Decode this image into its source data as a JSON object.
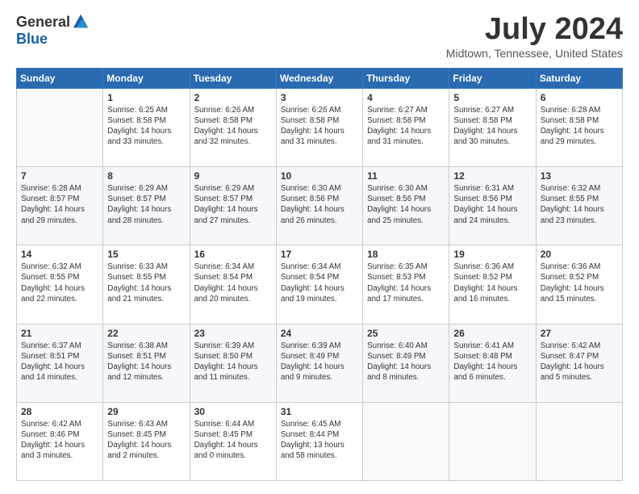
{
  "logo": {
    "general": "General",
    "blue": "Blue"
  },
  "title": "July 2024",
  "subtitle": "Midtown, Tennessee, United States",
  "days_of_week": [
    "Sunday",
    "Monday",
    "Tuesday",
    "Wednesday",
    "Thursday",
    "Friday",
    "Saturday"
  ],
  "weeks": [
    [
      {
        "day": "",
        "info": ""
      },
      {
        "day": "1",
        "info": "Sunrise: 6:25 AM\nSunset: 8:58 PM\nDaylight: 14 hours\nand 33 minutes."
      },
      {
        "day": "2",
        "info": "Sunrise: 6:26 AM\nSunset: 8:58 PM\nDaylight: 14 hours\nand 32 minutes."
      },
      {
        "day": "3",
        "info": "Sunrise: 6:26 AM\nSunset: 8:58 PM\nDaylight: 14 hours\nand 31 minutes."
      },
      {
        "day": "4",
        "info": "Sunrise: 6:27 AM\nSunset: 8:58 PM\nDaylight: 14 hours\nand 31 minutes."
      },
      {
        "day": "5",
        "info": "Sunrise: 6:27 AM\nSunset: 8:58 PM\nDaylight: 14 hours\nand 30 minutes."
      },
      {
        "day": "6",
        "info": "Sunrise: 6:28 AM\nSunset: 8:58 PM\nDaylight: 14 hours\nand 29 minutes."
      }
    ],
    [
      {
        "day": "7",
        "info": "Sunrise: 6:28 AM\nSunset: 8:57 PM\nDaylight: 14 hours\nand 29 minutes."
      },
      {
        "day": "8",
        "info": "Sunrise: 6:29 AM\nSunset: 8:57 PM\nDaylight: 14 hours\nand 28 minutes."
      },
      {
        "day": "9",
        "info": "Sunrise: 6:29 AM\nSunset: 8:57 PM\nDaylight: 14 hours\nand 27 minutes."
      },
      {
        "day": "10",
        "info": "Sunrise: 6:30 AM\nSunset: 8:56 PM\nDaylight: 14 hours\nand 26 minutes."
      },
      {
        "day": "11",
        "info": "Sunrise: 6:30 AM\nSunset: 8:56 PM\nDaylight: 14 hours\nand 25 minutes."
      },
      {
        "day": "12",
        "info": "Sunrise: 6:31 AM\nSunset: 8:56 PM\nDaylight: 14 hours\nand 24 minutes."
      },
      {
        "day": "13",
        "info": "Sunrise: 6:32 AM\nSunset: 8:55 PM\nDaylight: 14 hours\nand 23 minutes."
      }
    ],
    [
      {
        "day": "14",
        "info": "Sunrise: 6:32 AM\nSunset: 8:55 PM\nDaylight: 14 hours\nand 22 minutes."
      },
      {
        "day": "15",
        "info": "Sunrise: 6:33 AM\nSunset: 8:55 PM\nDaylight: 14 hours\nand 21 minutes."
      },
      {
        "day": "16",
        "info": "Sunrise: 6:34 AM\nSunset: 8:54 PM\nDaylight: 14 hours\nand 20 minutes."
      },
      {
        "day": "17",
        "info": "Sunrise: 6:34 AM\nSunset: 8:54 PM\nDaylight: 14 hours\nand 19 minutes."
      },
      {
        "day": "18",
        "info": "Sunrise: 6:35 AM\nSunset: 8:53 PM\nDaylight: 14 hours\nand 17 minutes."
      },
      {
        "day": "19",
        "info": "Sunrise: 6:36 AM\nSunset: 8:52 PM\nDaylight: 14 hours\nand 16 minutes."
      },
      {
        "day": "20",
        "info": "Sunrise: 6:36 AM\nSunset: 8:52 PM\nDaylight: 14 hours\nand 15 minutes."
      }
    ],
    [
      {
        "day": "21",
        "info": "Sunrise: 6:37 AM\nSunset: 8:51 PM\nDaylight: 14 hours\nand 14 minutes."
      },
      {
        "day": "22",
        "info": "Sunrise: 6:38 AM\nSunset: 8:51 PM\nDaylight: 14 hours\nand 12 minutes."
      },
      {
        "day": "23",
        "info": "Sunrise: 6:39 AM\nSunset: 8:50 PM\nDaylight: 14 hours\nand 11 minutes."
      },
      {
        "day": "24",
        "info": "Sunrise: 6:39 AM\nSunset: 8:49 PM\nDaylight: 14 hours\nand 9 minutes."
      },
      {
        "day": "25",
        "info": "Sunrise: 6:40 AM\nSunset: 8:49 PM\nDaylight: 14 hours\nand 8 minutes."
      },
      {
        "day": "26",
        "info": "Sunrise: 6:41 AM\nSunset: 8:48 PM\nDaylight: 14 hours\nand 6 minutes."
      },
      {
        "day": "27",
        "info": "Sunrise: 6:42 AM\nSunset: 8:47 PM\nDaylight: 14 hours\nand 5 minutes."
      }
    ],
    [
      {
        "day": "28",
        "info": "Sunrise: 6:42 AM\nSunset: 8:46 PM\nDaylight: 14 hours\nand 3 minutes."
      },
      {
        "day": "29",
        "info": "Sunrise: 6:43 AM\nSunset: 8:45 PM\nDaylight: 14 hours\nand 2 minutes."
      },
      {
        "day": "30",
        "info": "Sunrise: 6:44 AM\nSunset: 8:45 PM\nDaylight: 14 hours\nand 0 minutes."
      },
      {
        "day": "31",
        "info": "Sunrise: 6:45 AM\nSunset: 8:44 PM\nDaylight: 13 hours\nand 58 minutes."
      },
      {
        "day": "",
        "info": ""
      },
      {
        "day": "",
        "info": ""
      },
      {
        "day": "",
        "info": ""
      }
    ]
  ]
}
